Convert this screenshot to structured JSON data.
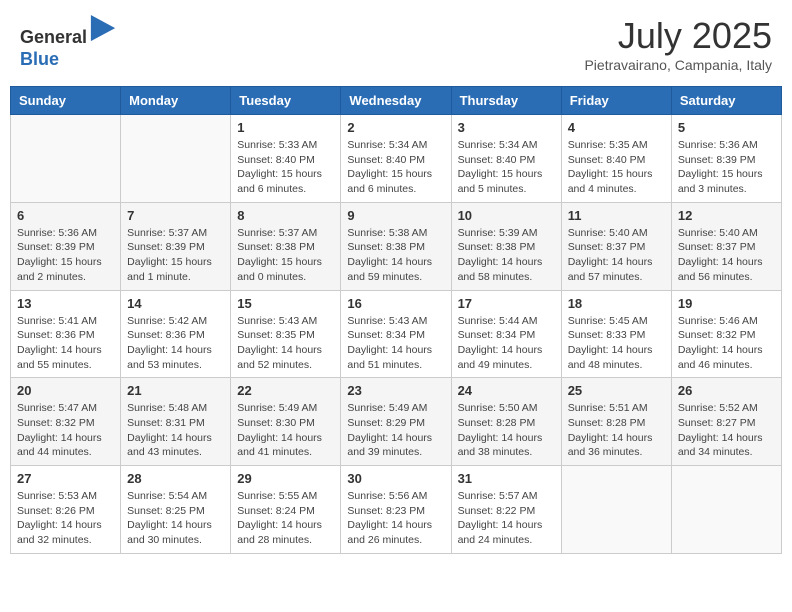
{
  "header": {
    "logo_general": "General",
    "logo_blue": "Blue",
    "month": "July 2025",
    "location": "Pietravairano, Campania, Italy"
  },
  "days_of_week": [
    "Sunday",
    "Monday",
    "Tuesday",
    "Wednesday",
    "Thursday",
    "Friday",
    "Saturday"
  ],
  "weeks": [
    [
      {
        "day": "",
        "info": ""
      },
      {
        "day": "",
        "info": ""
      },
      {
        "day": "1",
        "info": "Sunrise: 5:33 AM\nSunset: 8:40 PM\nDaylight: 15 hours and 6 minutes."
      },
      {
        "day": "2",
        "info": "Sunrise: 5:34 AM\nSunset: 8:40 PM\nDaylight: 15 hours and 6 minutes."
      },
      {
        "day": "3",
        "info": "Sunrise: 5:34 AM\nSunset: 8:40 PM\nDaylight: 15 hours and 5 minutes."
      },
      {
        "day": "4",
        "info": "Sunrise: 5:35 AM\nSunset: 8:40 PM\nDaylight: 15 hours and 4 minutes."
      },
      {
        "day": "5",
        "info": "Sunrise: 5:36 AM\nSunset: 8:39 PM\nDaylight: 15 hours and 3 minutes."
      }
    ],
    [
      {
        "day": "6",
        "info": "Sunrise: 5:36 AM\nSunset: 8:39 PM\nDaylight: 15 hours and 2 minutes."
      },
      {
        "day": "7",
        "info": "Sunrise: 5:37 AM\nSunset: 8:39 PM\nDaylight: 15 hours and 1 minute."
      },
      {
        "day": "8",
        "info": "Sunrise: 5:37 AM\nSunset: 8:38 PM\nDaylight: 15 hours and 0 minutes."
      },
      {
        "day": "9",
        "info": "Sunrise: 5:38 AM\nSunset: 8:38 PM\nDaylight: 14 hours and 59 minutes."
      },
      {
        "day": "10",
        "info": "Sunrise: 5:39 AM\nSunset: 8:38 PM\nDaylight: 14 hours and 58 minutes."
      },
      {
        "day": "11",
        "info": "Sunrise: 5:40 AM\nSunset: 8:37 PM\nDaylight: 14 hours and 57 minutes."
      },
      {
        "day": "12",
        "info": "Sunrise: 5:40 AM\nSunset: 8:37 PM\nDaylight: 14 hours and 56 minutes."
      }
    ],
    [
      {
        "day": "13",
        "info": "Sunrise: 5:41 AM\nSunset: 8:36 PM\nDaylight: 14 hours and 55 minutes."
      },
      {
        "day": "14",
        "info": "Sunrise: 5:42 AM\nSunset: 8:36 PM\nDaylight: 14 hours and 53 minutes."
      },
      {
        "day": "15",
        "info": "Sunrise: 5:43 AM\nSunset: 8:35 PM\nDaylight: 14 hours and 52 minutes."
      },
      {
        "day": "16",
        "info": "Sunrise: 5:43 AM\nSunset: 8:34 PM\nDaylight: 14 hours and 51 minutes."
      },
      {
        "day": "17",
        "info": "Sunrise: 5:44 AM\nSunset: 8:34 PM\nDaylight: 14 hours and 49 minutes."
      },
      {
        "day": "18",
        "info": "Sunrise: 5:45 AM\nSunset: 8:33 PM\nDaylight: 14 hours and 48 minutes."
      },
      {
        "day": "19",
        "info": "Sunrise: 5:46 AM\nSunset: 8:32 PM\nDaylight: 14 hours and 46 minutes."
      }
    ],
    [
      {
        "day": "20",
        "info": "Sunrise: 5:47 AM\nSunset: 8:32 PM\nDaylight: 14 hours and 44 minutes."
      },
      {
        "day": "21",
        "info": "Sunrise: 5:48 AM\nSunset: 8:31 PM\nDaylight: 14 hours and 43 minutes."
      },
      {
        "day": "22",
        "info": "Sunrise: 5:49 AM\nSunset: 8:30 PM\nDaylight: 14 hours and 41 minutes."
      },
      {
        "day": "23",
        "info": "Sunrise: 5:49 AM\nSunset: 8:29 PM\nDaylight: 14 hours and 39 minutes."
      },
      {
        "day": "24",
        "info": "Sunrise: 5:50 AM\nSunset: 8:28 PM\nDaylight: 14 hours and 38 minutes."
      },
      {
        "day": "25",
        "info": "Sunrise: 5:51 AM\nSunset: 8:28 PM\nDaylight: 14 hours and 36 minutes."
      },
      {
        "day": "26",
        "info": "Sunrise: 5:52 AM\nSunset: 8:27 PM\nDaylight: 14 hours and 34 minutes."
      }
    ],
    [
      {
        "day": "27",
        "info": "Sunrise: 5:53 AM\nSunset: 8:26 PM\nDaylight: 14 hours and 32 minutes."
      },
      {
        "day": "28",
        "info": "Sunrise: 5:54 AM\nSunset: 8:25 PM\nDaylight: 14 hours and 30 minutes."
      },
      {
        "day": "29",
        "info": "Sunrise: 5:55 AM\nSunset: 8:24 PM\nDaylight: 14 hours and 28 minutes."
      },
      {
        "day": "30",
        "info": "Sunrise: 5:56 AM\nSunset: 8:23 PM\nDaylight: 14 hours and 26 minutes."
      },
      {
        "day": "31",
        "info": "Sunrise: 5:57 AM\nSunset: 8:22 PM\nDaylight: 14 hours and 24 minutes."
      },
      {
        "day": "",
        "info": ""
      },
      {
        "day": "",
        "info": ""
      }
    ]
  ]
}
